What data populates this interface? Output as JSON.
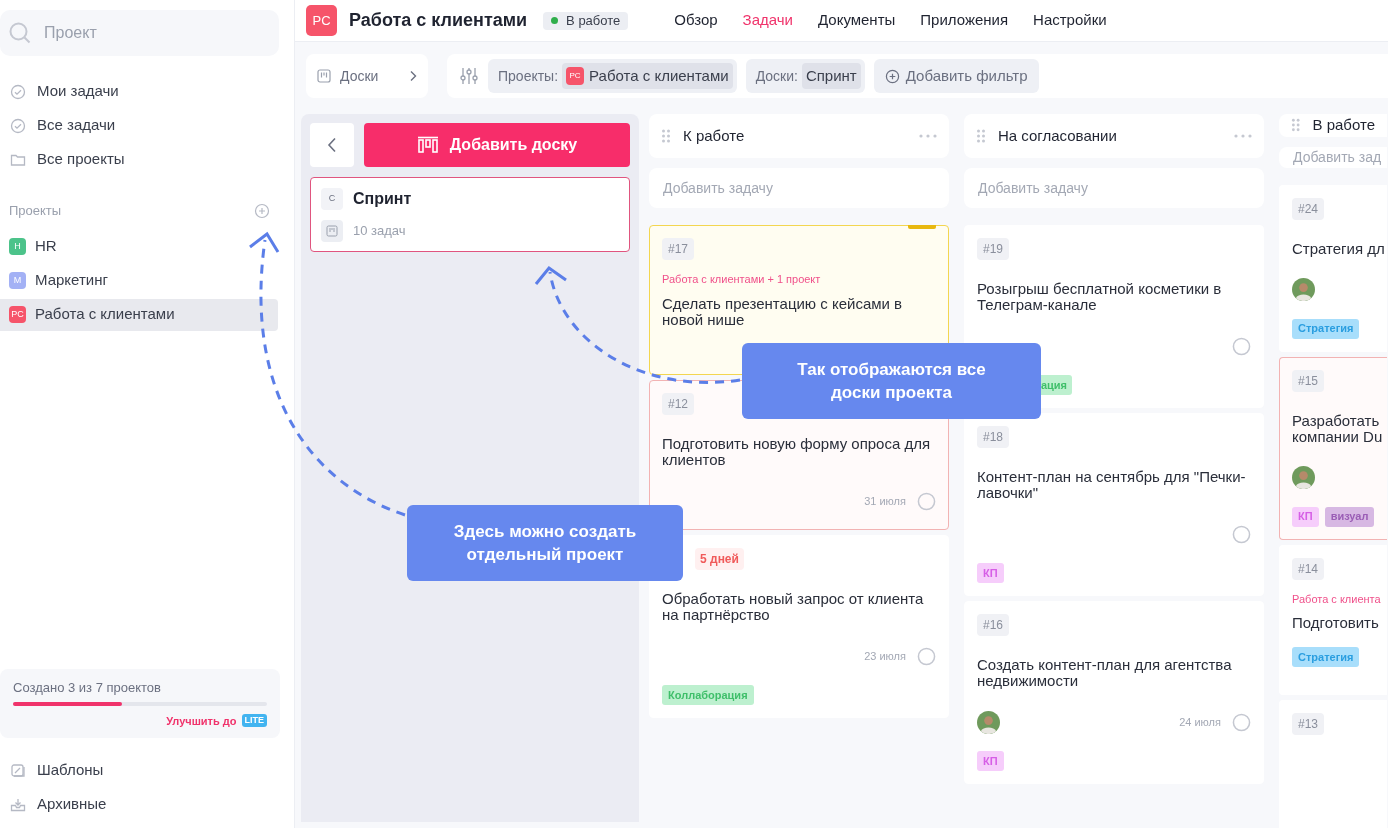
{
  "sidebar": {
    "search": {
      "placeholder": "Проект"
    },
    "nav": [
      {
        "label": "Мои задачи",
        "kind": "check"
      },
      {
        "label": "Все задачи",
        "kind": "check"
      },
      {
        "label": "Все проекты",
        "kind": "folder"
      }
    ],
    "projects_title": "Проекты",
    "projects": [
      {
        "badge": "H",
        "label": "HR",
        "color": "#4cc38a",
        "selected": false
      },
      {
        "badge": "M",
        "label": "Маркетинг",
        "color": "#a3b1f5",
        "selected": false
      },
      {
        "badge": "PC",
        "label": "Работа с клиентами",
        "color": "#f6546a",
        "selected": true
      }
    ],
    "usage": {
      "text": "Создано 3 из 7 проектов",
      "level": 0.43,
      "upgrade": "Улучшить до",
      "plan": "LITE"
    },
    "footer": [
      {
        "label": "Шаблоны",
        "kind": "templates"
      },
      {
        "label": "Архивные",
        "kind": "archive"
      }
    ]
  },
  "header": {
    "avatar": "PC",
    "title": "Работа с клиентами",
    "status": "В работе",
    "tabs": [
      {
        "label": "Обзор",
        "selected": false
      },
      {
        "label": "Задачи",
        "selected": true
      },
      {
        "label": "Документы",
        "selected": false
      },
      {
        "label": "Приложения",
        "selected": false
      },
      {
        "label": "Настройки",
        "selected": false
      }
    ]
  },
  "filters": {
    "boards": "Доски",
    "chips": [
      {
        "label": "Проекты:",
        "avatar": "PC",
        "value": "Работа с клиентами"
      },
      {
        "label": "Доски:",
        "value": "Спринт"
      }
    ],
    "add": "Добавить фильтр"
  },
  "boards_panel": {
    "add": "Добавить доску",
    "boards": [
      {
        "letter": "С",
        "name": "Спринт",
        "count": "10 задач",
        "selected": true
      }
    ]
  },
  "columns": [
    {
      "title": "К работе",
      "menu": true,
      "add": "Добавить задачу",
      "cards": [
        {
          "kind": "highlighted",
          "id": "#17",
          "project": "Работа с клиентами + 1 проект",
          "title": "Сделать презентацию с кейсами в новой нише"
        },
        {
          "kind": "overdue",
          "id": "#12",
          "title": "Подготовить новую форму опроса для клиентов",
          "date": "31 июля",
          "check": true
        },
        {
          "kind": "normal",
          "deadline": "5 дней",
          "title": "Обработать новый запрос от клиента на партнёрство",
          "date": "23 июля",
          "check": true,
          "tags": [
            {
              "label": "Коллаборация",
              "kind": "collab"
            }
          ]
        }
      ]
    },
    {
      "title": "На согласовании",
      "menu": true,
      "add": "Добавить задачу",
      "cards": [
        {
          "kind": "normal",
          "id": "#19",
          "title": "Розыгрыш бесплатной косметики в Телеграм-канале",
          "check": true,
          "tags": [
            {
              "label": "ация",
              "kind": "collab",
              "covered": true
            }
          ]
        },
        {
          "kind": "normal",
          "id": "#18",
          "title": "Контент-план на сентябрь для \"Печки-лавочки\"",
          "check": true,
          "tags": [
            {
              "label": "КП",
              "kind": "kp"
            }
          ]
        },
        {
          "kind": "normal",
          "id": "#16",
          "title": "Создать контент-план для агентства недвижимости",
          "avatar": true,
          "date": "24 июля",
          "check": true,
          "tags": [
            {
              "label": "КП",
              "kind": "kp"
            }
          ]
        }
      ]
    },
    {
      "title": "В работе",
      "menu": false,
      "add": "Добавить зад",
      "cards": [
        {
          "kind": "normal",
          "id": "#24",
          "title": "Стратегия дл",
          "avatar": true,
          "tags": [
            {
              "label": "Стратегия",
              "kind": "strategy"
            }
          ]
        },
        {
          "kind": "overdue",
          "id": "#15",
          "title": "Разработать компании Du",
          "avatar": true,
          "tags": [
            {
              "label": "КП",
              "kind": "kp"
            },
            {
              "label": "визуал",
              "kind": "visual"
            }
          ]
        },
        {
          "kind": "normal",
          "id": "#14",
          "project": "Работа с клиента",
          "title": "Подготовить",
          "tags": [
            {
              "label": "Стратегия",
              "kind": "strategy"
            }
          ]
        },
        {
          "kind": "normal",
          "id": "#13"
        }
      ]
    }
  ],
  "callouts": [
    {
      "text": "Так отображаются все доски проекта"
    },
    {
      "text": "Здесь можно создать отдельный проект"
    }
  ]
}
